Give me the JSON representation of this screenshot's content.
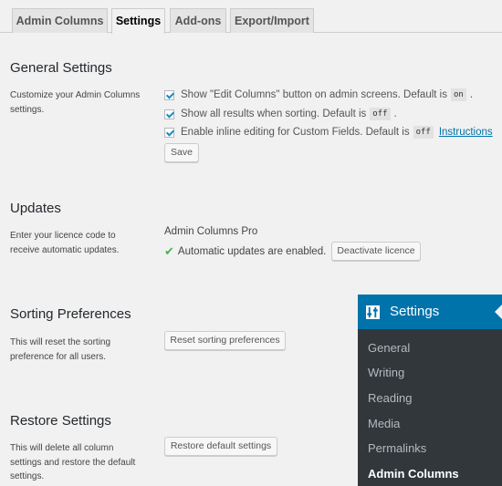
{
  "tabs": [
    {
      "label": "Admin Columns"
    },
    {
      "label": "Settings"
    },
    {
      "label": "Add-ons"
    },
    {
      "label": "Export/Import"
    }
  ],
  "general": {
    "title": "General Settings",
    "description": "Customize your Admin Columns settings.",
    "options": [
      {
        "label": "Show \"Edit Columns\" button on admin screens. Default is",
        "default": "on",
        "suffix": "."
      },
      {
        "label": "Show all results when sorting. Default is",
        "default": "off",
        "suffix": "."
      },
      {
        "label": "Enable inline editing for Custom Fields. Default is",
        "default": "off",
        "link": "Instructions"
      }
    ],
    "save_label": "Save"
  },
  "updates": {
    "title": "Updates",
    "description": "Enter your licence code to receive automatic updates.",
    "product": "Admin Columns Pro",
    "status": "Automatic updates are enabled.",
    "deactivate_label": "Deactivate licence"
  },
  "sorting": {
    "title": "Sorting Preferences",
    "description": "This will reset the sorting preference for all users.",
    "button_label": "Reset sorting preferences"
  },
  "restore": {
    "title": "Restore Settings",
    "description": "This will delete all column settings and restore the default settings.",
    "button_label": "Restore default settings"
  },
  "admin_menu": {
    "title": "Settings",
    "items": [
      {
        "label": "General"
      },
      {
        "label": "Writing"
      },
      {
        "label": "Reading"
      },
      {
        "label": "Media"
      },
      {
        "label": "Permalinks"
      },
      {
        "label": "Admin Columns"
      }
    ]
  },
  "colors": {
    "menu_bg": "#32373c",
    "menu_active": "#0073aa",
    "check": "#46b450"
  }
}
